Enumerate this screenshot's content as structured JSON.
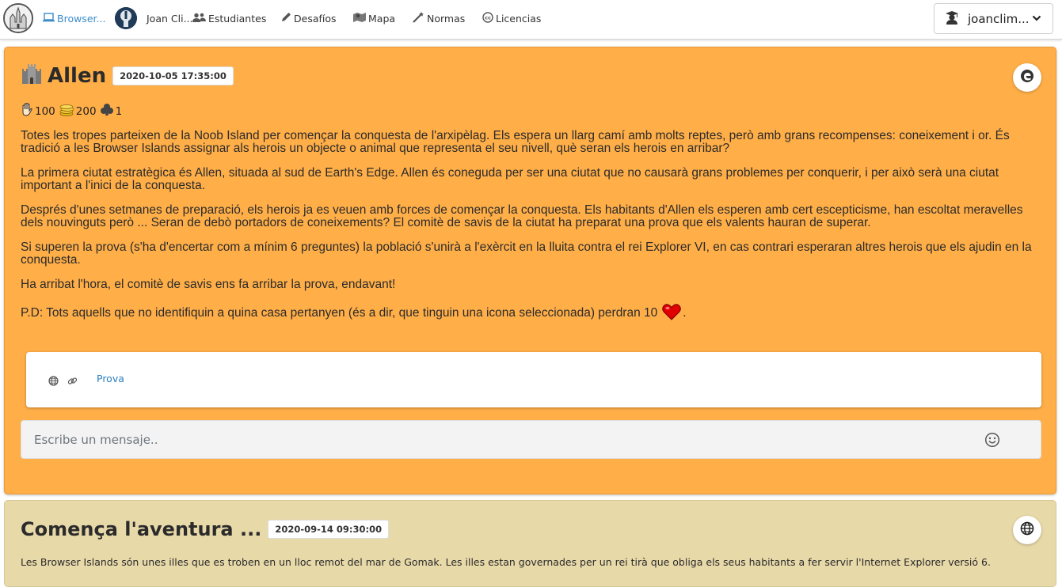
{
  "nav": {
    "browser_label": "Browser...",
    "user_short": "Joan Cli...",
    "students": "Estudiantes",
    "challenges": "Desafíos",
    "map": "Mapa",
    "rules": "Normas",
    "licenses": "Licencias",
    "username": "joanclim..."
  },
  "main_card": {
    "title": "Allen",
    "date": "2020-10-05 17:35:00",
    "stats": {
      "hp": "100",
      "coins": "200",
      "clubs": "1"
    },
    "paragraphs": [
      "Totes les tropes parteixen de la Noob Island per començar la conquesta de l'arxipèlag. Els espera un llarg camí amb molts reptes, però amb grans recompenses: coneixement i or. És tradició a les Browser Islands assignar als herois un objecte o animal que representa el seu nivell, què seran els herois en arribar?",
      "La primera ciutat estratègica és Allen, situada al sud de Earth's Edge. Allen és coneguda per ser una ciutat que no causarà grans problemes per conquerir, i per això serà una ciutat important a l'inici de la conquesta.",
      "Després d'unes setmanes de preparació, els herois ja es veuen amb forces de començar la conquesta. Els habitants d'Allen els esperen amb cert escepticisme, han escoltat meravelles dels nouvinguts però ... Seran de debò portadors de coneixements? El comitè de savis de la ciutat ha preparat una prova que els valents hauran de superar.",
      "Si superen la prova (s'ha d'encertar com a mínim 6 preguntes) la població s'unirà a l'exèrcit en la lluita contra el rei Explorer VI, en cas contrari esperaran altres herois que els ajudin en la conquesta.",
      "Ha arribat l'hora, el comitè de savis ens fa arribar la prova, endavant!"
    ],
    "pd_text": "P.D: Tots aquells que no identifiquin a quina casa pertanyen (és a dir, que tinguin una icona seleccionada) perdran 10",
    "pd_end": ".",
    "link_label": "Prova",
    "message_placeholder": "Escribe un mensaje.."
  },
  "second_card": {
    "title": "Comença l'aventura ...",
    "date": "2020-09-14 09:30:00",
    "text": "Les Browser Islands són unes illes que es troben en un lloc remot del mar de Gomak. Les illes estan governades per un rei tirà que obliga els seus habitants a fer servir l'Internet Explorer versió 6."
  },
  "colors": {
    "main_card_bg": "#ffae48",
    "second_card_bg": "#e8d9a9",
    "link_color": "#2a7fc1",
    "active_nav": "#3a8cc9"
  },
  "icons": {
    "logo": "castle-logo-icon",
    "browser": "laptop-icon",
    "students": "users-icon",
    "challenges": "pencil-icon",
    "map": "map-icon",
    "rules": "magic-wand-icon",
    "licenses": "creative-commons-icon",
    "user": "graduate-icon",
    "refresh": "edge-browser-icon",
    "globe": "globe-icon",
    "link": "link-icon",
    "emoji": "smiley-icon",
    "heart": "heart-icon"
  }
}
